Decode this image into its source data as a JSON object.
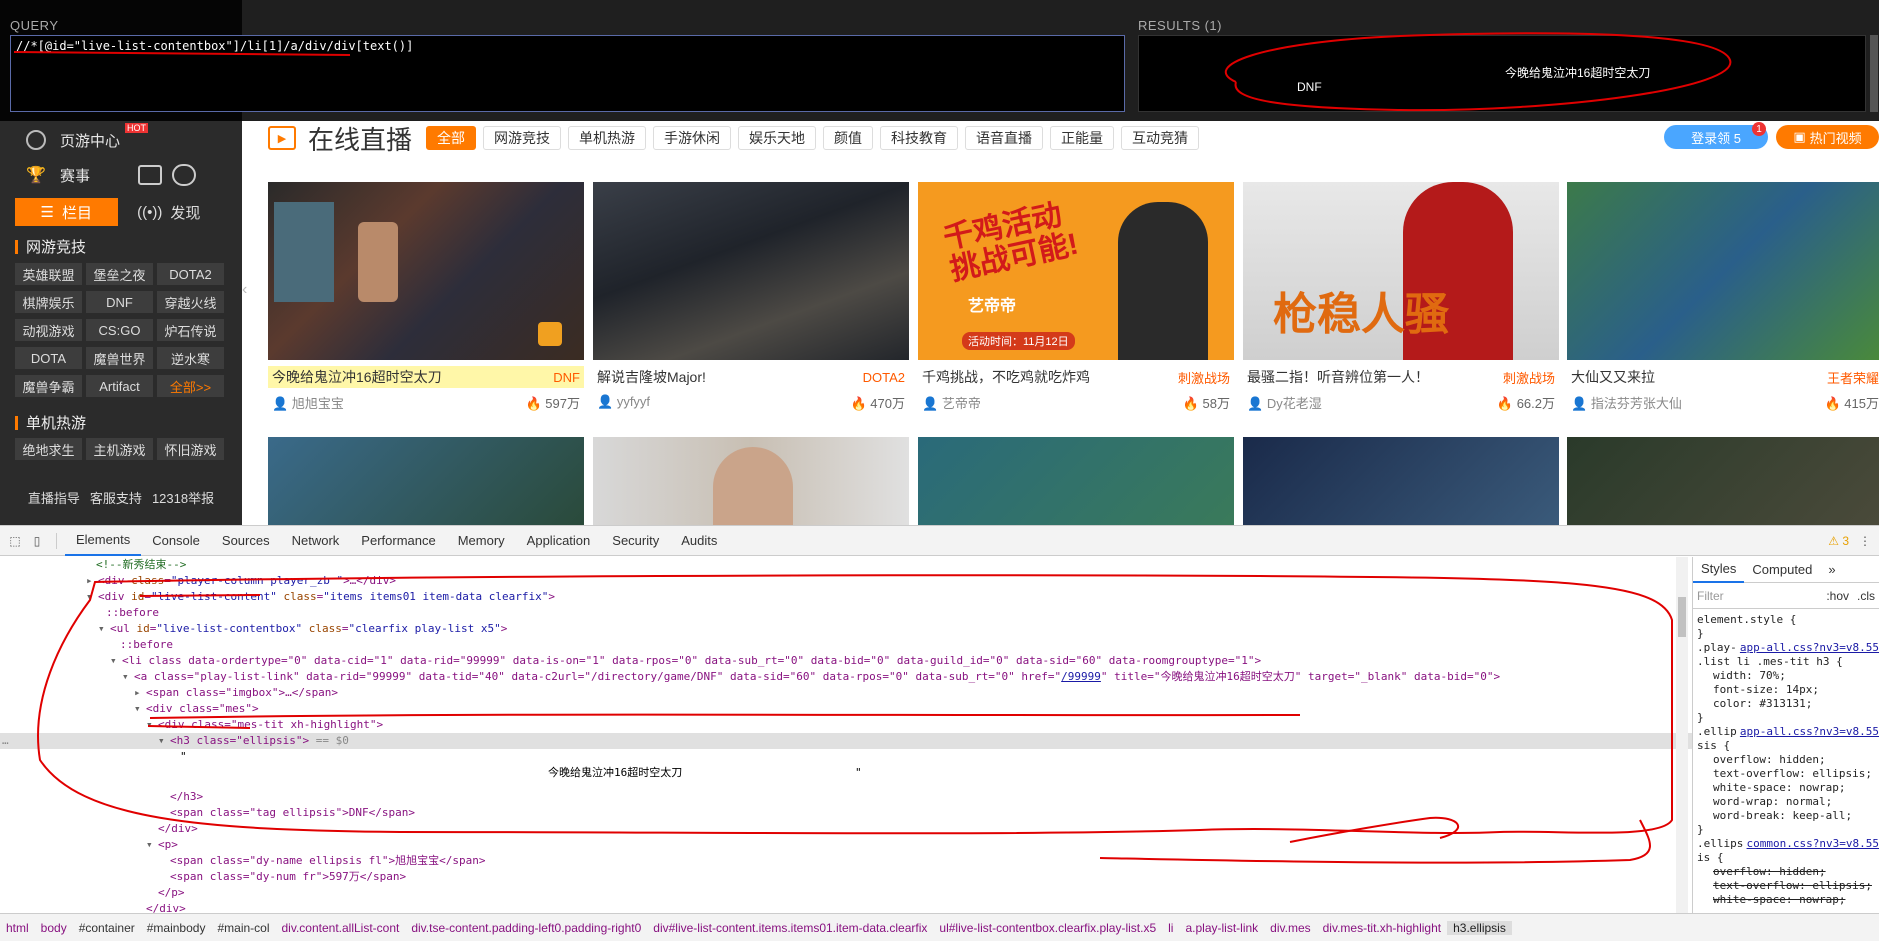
{
  "query_panel": {
    "query_label": "QUERY",
    "results_label": "RESULTS (1)",
    "xpath": "//*[@id=\"live-list-contentbox\"]/li[1]/a/div/div[text()]",
    "result_title": "今晚给鬼泣冲16超时空太刀",
    "result_tag": "DNF"
  },
  "sidebar": {
    "items": [
      {
        "label": "页游中心",
        "badge": "HOT"
      },
      {
        "label": "赛事"
      }
    ],
    "tabs": [
      "栏目",
      "发现"
    ],
    "section_esports": "网游竞技",
    "esports_games": [
      "英雄联盟",
      "堡垒之夜",
      "DOTA2",
      "棋牌娱乐",
      "DNF",
      "穿越火线",
      "动视游戏",
      "CS:GO",
      "炉石传说",
      "DOTA",
      "魔兽世界",
      "逆水寒",
      "魔兽争霸",
      "Artifact",
      "全部>>"
    ],
    "section_single": "单机热游",
    "single_games": [
      "绝地求生",
      "主机游戏",
      "怀旧游戏"
    ],
    "footer": [
      "直播指导",
      "客服支持",
      "12318举报"
    ]
  },
  "main": {
    "title": "在线直播",
    "categories": [
      "全部",
      "网游竞技",
      "单机热游",
      "手游休闲",
      "娱乐天地",
      "颜值",
      "科技教育",
      "语音直播",
      "正能量",
      "互动竞猜"
    ],
    "login_btn": "登录领 5",
    "login_badge": "1",
    "hot_video_btn": "热门视频",
    "cards": [
      {
        "title": "今晚给鬼泣冲16超时空太刀",
        "tag": "DNF",
        "author": "旭旭宝宝",
        "views": "597万"
      },
      {
        "title": "解说吉隆坡Major!",
        "tag": "DOTA2",
        "author": "yyfyyf",
        "views": "470万"
      },
      {
        "title": "千鸡挑战，不吃鸡就吃炸鸡",
        "tag": "刺激战场",
        "author": "艺帝帝",
        "views": "58万"
      },
      {
        "title": "最骚二指！听音辨位第一人！",
        "tag": "刺激战场",
        "author": "Dy花老湿",
        "views": "66.2万"
      },
      {
        "title": "大仙又又来拉",
        "tag": "王者荣耀",
        "author": "指法芬芳张大仙",
        "views": "415万"
      }
    ],
    "promo_lines": [
      "千鸡活动",
      "挑战可能!",
      "艺帝帝",
      "活动时间：11月12日"
    ],
    "promo2": "枪稳人骚"
  },
  "devtools": {
    "tabs": [
      "Elements",
      "Console",
      "Sources",
      "Network",
      "Performance",
      "Memory",
      "Application",
      "Security",
      "Audits"
    ],
    "warning_count": "3",
    "lines": {
      "l0": "<!--新秀结束-->",
      "l1_tag": "div",
      "l1_attr": "class",
      "l1_val": "\"player-column player_zb \"",
      "l2_id": "\"live-list-content\"",
      "l2_class": "\"items items01 item-data clearfix\"",
      "l3": "::before",
      "l4_id": "\"live-list-contentbox\"",
      "l4_class": "\"clearfix play-list x5\"",
      "l5": "::before",
      "l6": "<li class data-ordertype=\"0\" data-cid=\"1\" data-rid=\"99999\" data-is-on=\"1\" data-rpos=\"0\" data-sub_rt=\"0\" data-bid=\"0\" data-guild_id=\"0\" data-sid=\"60\" data-roomgrouptype=\"1\">",
      "l7_pre": "<a class=\"play-list-link\" data-rid=\"99999\" data-tid=\"40\" data-c2url=\"/directory/game/DNF\" data-sid=\"60\" data-rpos=\"0\" data-sub_rt=\"0\" href=\"",
      "l7_link": "/99999",
      "l7_post": "\" title=\"今晚给鬼泣冲16超时空太刀\" target=\"_blank\" data-bid=\"0\">",
      "l8": "<span class=\"imgbox\">…</span>",
      "l9": "<div class=\"mes\">",
      "l10": "<div class=\"mes-tit xh-highlight\">",
      "l11": "<h3 class=\"ellipsis\">",
      "l11_eq": " == $0",
      "l12": "\"",
      "l13_text": "今晚给鬼泣冲16超时空太刀",
      "l13_end": "\"",
      "l14": "</h3>",
      "l15": "<span class=\"tag ellipsis\">DNF</span>",
      "l16": "</div>",
      "l17": "<p>",
      "l18": "<span class=\"dy-name ellipsis fl\">旭旭宝宝</span>",
      "l19": "<span class=\"dy-num fr\">597万</span>",
      "l20": "</p>",
      "l21": "</div>",
      "l22": "</a>"
    },
    "styles": {
      "tabs": [
        "Styles",
        "Computed"
      ],
      "filter": "Filter",
      "hov": ":hov",
      "cls": ".cls",
      "lines": [
        "element.style {",
        "}",
        ".play-",
        ".list li .mes-tit h3 {",
        "width: 70%;",
        "font-size: 14px;",
        "color: #313131;",
        "}",
        ".ellip",
        "sis {",
        "overflow: hidden;",
        "text-overflow: ellipsis;",
        "white-space: nowrap;",
        "word-wrap: normal;",
        "word-break: keep-all;",
        "}",
        ".ellips",
        "is {",
        "overflow: hidden;",
        "text-overflow: ellipsis;",
        "white-space: nowrap;"
      ],
      "src1": "app-all.css?nv3=v8.55",
      "src2": "app-all.css?nv3=v8.55",
      "src3": "common.css?nv3=v8.55"
    },
    "breadcrumbs": [
      "html",
      "body",
      "#container",
      "#mainbody",
      "#main-col",
      "div.content.allList-cont",
      "div.tse-content.padding-left0.padding-right0",
      "div#live-list-content.items.items01.item-data.clearfix",
      "ul#live-list-contentbox.clearfix.play-list.x5",
      "li",
      "a.play-list-link",
      "div.mes",
      "div.mes-tit.xh-highlight",
      "h3.ellipsis"
    ]
  },
  "colors": {
    "accent": "#ff7a00",
    "annotation": "#e00000"
  }
}
